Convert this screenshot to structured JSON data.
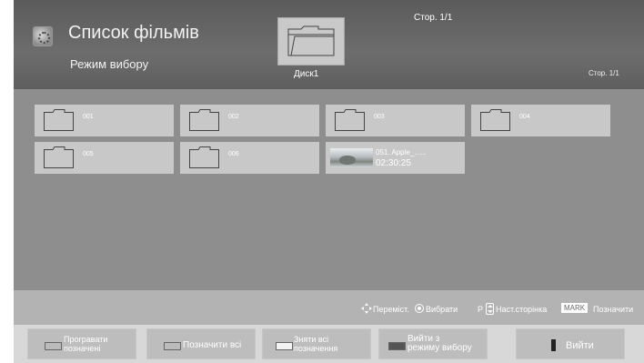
{
  "header": {
    "title": "Список фільмів",
    "subtitle": "Режим вибору",
    "top_page": "Стор. 1/1",
    "device_label": "Диск1",
    "page_indicator": "Стор. 1/1"
  },
  "items": [
    {
      "type": "folder",
      "label": "001"
    },
    {
      "type": "folder",
      "label": "002"
    },
    {
      "type": "folder",
      "label": "003"
    },
    {
      "type": "folder",
      "label": "004"
    },
    {
      "type": "folder",
      "label": "005"
    },
    {
      "type": "folder",
      "label": "006"
    },
    {
      "type": "video",
      "label": "051. Apple_......",
      "duration": "02:30:25"
    }
  ],
  "hints": {
    "move": "Переміст.",
    "select": "Вибрати",
    "p_key": "P",
    "next_page": "Наст.сторінка",
    "mark_key": "MARK",
    "mark": "Позначити"
  },
  "footer": {
    "play_marked_line1": "Програвати",
    "play_marked_line2": "позначені",
    "mark_all": "Позначити всі",
    "unmark_all_line1": "Зняти всі",
    "unmark_all_line2": "позначення",
    "exit_select_line1": "Вийти з",
    "exit_select_line2": "режиму вибору",
    "exit": "Вийти"
  },
  "colors": {
    "header": "#636363",
    "content": "#8e8e8e",
    "tile": "#c8c8c8",
    "chip_gray": "#bbbbbb",
    "chip_white": "#f4f4f4",
    "chip_dark": "#555555"
  }
}
